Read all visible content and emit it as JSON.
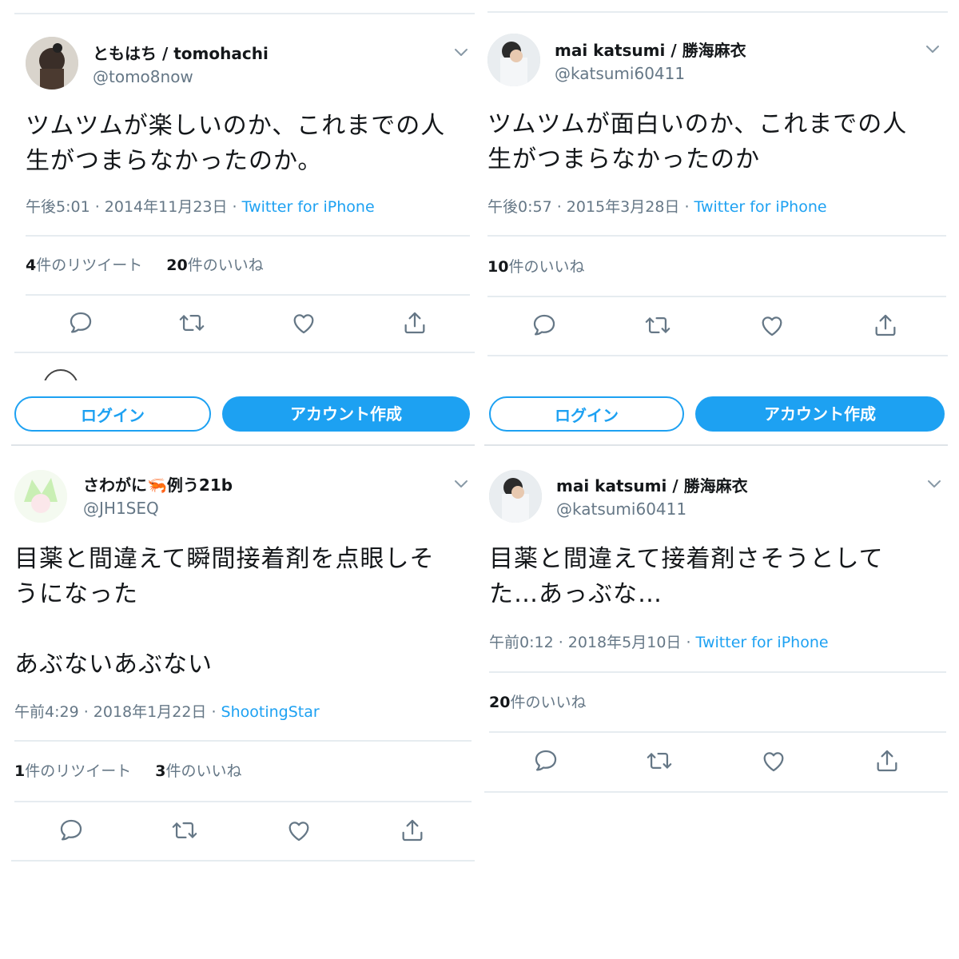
{
  "tweets": [
    {
      "name": "ともはち / tomohachi",
      "handle": "@tomo8now",
      "text": "ツムツムが楽しいのか、これまでの人\n生がつまらなかったのか。",
      "time": "午後5:01 · 2014年11月23日 · ",
      "source": "Twitter for iPhone",
      "retweets_count": "4",
      "retweets_label": "件のリツイート",
      "likes_count": "20",
      "likes_label": "件のいいね"
    },
    {
      "name": "mai katsumi / 勝海麻衣",
      "handle": "@katsumi60411",
      "text": "ツムツムが面白いのか、これまでの人\n生がつまらなかったのか",
      "time": "午後0:57 · 2015年3月28日 · ",
      "source": "Twitter for iPhone",
      "likes_count": "10",
      "likes_label": "件のいいね"
    },
    {
      "name": "さわがに🦐例う21b",
      "handle": "@JH1SEQ",
      "text": "目薬と間違えて瞬間接着剤を点眼しそ\nうになった\n\nあぶないあぶない",
      "time": "午前4:29 · 2018年1月22日 · ",
      "source": "ShootingStar",
      "retweets_count": "1",
      "retweets_label": "件のリツイート",
      "likes_count": "3",
      "likes_label": "件のいいね"
    },
    {
      "name": "mai katsumi / 勝海麻衣",
      "handle": "@katsumi60411",
      "text": "目薬と間違えて接着剤さそうとして\nた…あっぶな…",
      "time": "午前0:12 · 2018年5月10日 · ",
      "source": "Twitter for iPhone",
      "likes_count": "20",
      "likes_label": "件のいいね"
    }
  ],
  "buttons": {
    "login": "ログイン",
    "signup": "アカウント作成"
  },
  "icons": {
    "reply": "reply-icon",
    "retweet": "retweet-icon",
    "like": "heart-icon",
    "share": "share-icon",
    "more": "chevron-down-icon"
  },
  "colors": {
    "accent": "#1da1f2",
    "secondary_text": "#657786",
    "divider": "#e6ecf0"
  }
}
